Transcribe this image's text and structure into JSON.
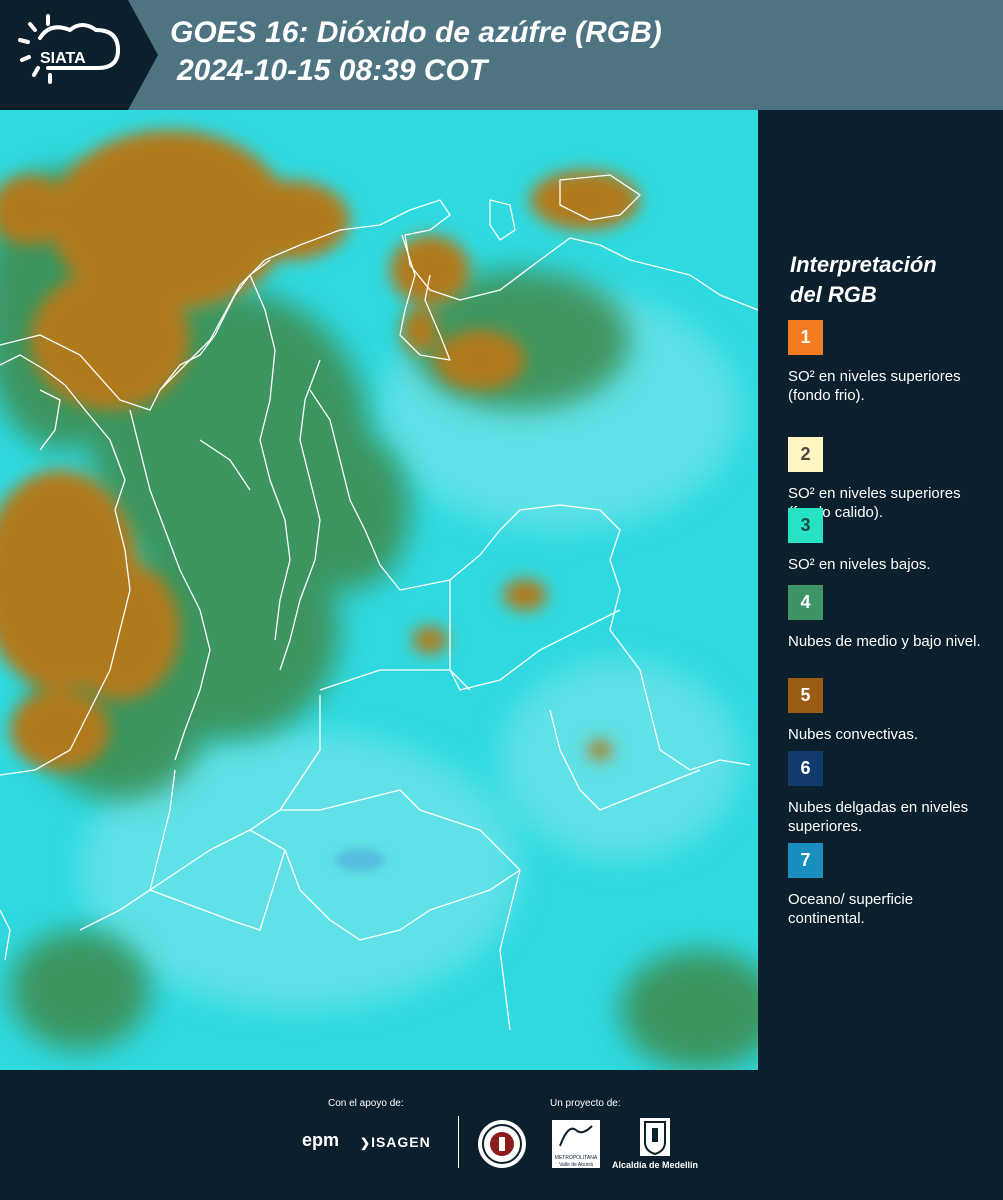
{
  "header": {
    "logo_text": "SIATA",
    "title_line1": "GOES 16: Dióxido de azúfre (RGB)",
    "title_line2": "2024-10-15 08:39 COT"
  },
  "legend": {
    "title_line1": "Interpretación",
    "title_line2": "del RGB",
    "items": [
      {
        "number": "1",
        "color": "#f47b20",
        "text_color": "#ffffff",
        "label": "SO² en niveles superiores (fondo frio)."
      },
      {
        "number": "2",
        "color": "#fff6c4",
        "text_color": "#4a4a4a",
        "label": "SO² en niveles superiores (fondo calido)."
      },
      {
        "number": "3",
        "color": "#27e3c4",
        "text_color": "#1b4a4a",
        "label": "SO² en niveles bajos."
      },
      {
        "number": "4",
        "color": "#3e9467",
        "text_color": "#ffffff",
        "label": "Nubes de medio y bajo nivel."
      },
      {
        "number": "5",
        "color": "#9a5b12",
        "text_color": "#ffffff",
        "label": "Nubes convectivas."
      },
      {
        "number": "6",
        "color": "#123a6b",
        "text_color": "#ffffff",
        "label": "Nubes delgadas en niveles superiores."
      },
      {
        "number": "7",
        "color": "#1a8fbf",
        "text_color": "#ffffff",
        "label": "Oceano/ superficie continental."
      }
    ]
  },
  "footer": {
    "support_label": "Con el apoyo de:",
    "project_label": "Un proyecto de:",
    "sponsor_epm": "epm",
    "sponsor_isagen": "ISAGEN",
    "partner_area_line1": "METROPOLITANA",
    "partner_area_line2": "Valle de Aburrá",
    "partner_alcaldia": "Alcaldía de Medellín"
  },
  "map": {
    "colors": {
      "ocean_land": "#2fd9e0",
      "convective": "#b07a1e",
      "mid_low_cloud": "#3c8f52",
      "borders": "#ffffff"
    }
  }
}
